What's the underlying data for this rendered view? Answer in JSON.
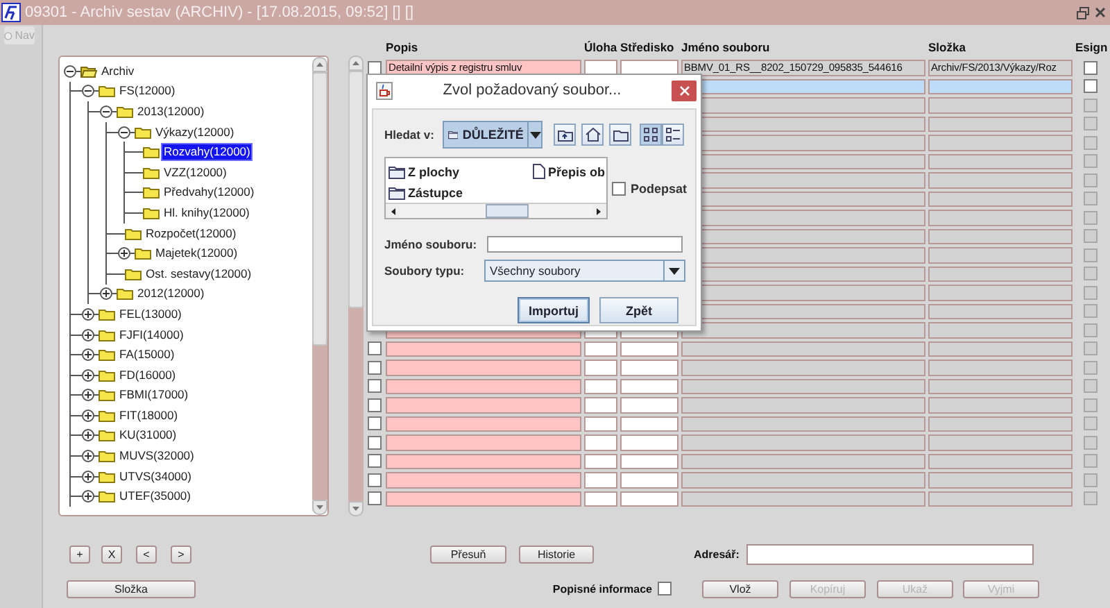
{
  "window": {
    "title": "09301 - Archiv sestav (ARCHIV) - [17.08.2015, 09:52] [] []"
  },
  "nav": {
    "label": "Nav",
    "disabled": true
  },
  "tree": {
    "items": [
      {
        "label": "Archiv",
        "expanded": true,
        "selected": false,
        "children": [
          {
            "label": "FS(12000)",
            "expanded": true,
            "selected": false,
            "children": [
              {
                "label": "2013(12000)",
                "expanded": true,
                "selected": false,
                "children": [
                  {
                    "label": "Výkazy(12000)",
                    "expanded": true,
                    "selected": false,
                    "children": [
                      {
                        "label": "Rozvahy(12000)",
                        "selected": true
                      },
                      {
                        "label": "VZZ(12000)",
                        "selected": false
                      },
                      {
                        "label": "Předvahy(12000)",
                        "selected": false
                      },
                      {
                        "label": "Hl. knihy(12000)",
                        "selected": false
                      }
                    ]
                  },
                  {
                    "label": "Rozpočet(12000)",
                    "selected": false
                  },
                  {
                    "label": "Majetek(12000)",
                    "expanded": false,
                    "selected": false
                  },
                  {
                    "label": "Ost. sestavy(12000)",
                    "selected": false
                  }
                ]
              },
              {
                "label": "2012(12000)",
                "expanded": false,
                "selected": false
              }
            ]
          },
          {
            "label": "FEL(13000)",
            "expanded": false,
            "selected": false
          },
          {
            "label": "FJFI(14000)",
            "expanded": false,
            "selected": false
          },
          {
            "label": "FA(15000)",
            "expanded": false,
            "selected": false
          },
          {
            "label": "FD(16000)",
            "expanded": false,
            "selected": false
          },
          {
            "label": "FBMI(17000)",
            "expanded": false,
            "selected": false
          },
          {
            "label": "FIT(18000)",
            "expanded": false,
            "selected": false
          },
          {
            "label": "KU(31000)",
            "expanded": false,
            "selected": false
          },
          {
            "label": "MUVS(32000)",
            "expanded": false,
            "selected": false
          },
          {
            "label": "UTVS(34000)",
            "expanded": false,
            "selected": false
          },
          {
            "label": "UTEF(35000)",
            "expanded": false,
            "selected": false
          }
        ]
      }
    ]
  },
  "table": {
    "columns": [
      "Popis",
      "Úloha",
      "Středisko",
      "Jméno souboru",
      "Složka",
      "Esign"
    ],
    "rows": [
      {
        "checked": false,
        "popis": "Detailní výpis z registru smluv",
        "soubor": "BBMV_01_RS__8202_150729_095835_544616",
        "slozka": "Archiv/FS/2013/Výkazy/Roz",
        "selected": false,
        "esign_checked": false,
        "esign_disabled": false
      },
      {
        "selected": true,
        "esign_checked": false,
        "esign_disabled": false
      },
      {
        "selected": false,
        "esign_checked": false,
        "esign_disabled": true
      },
      {
        "selected": false,
        "esign_checked": false,
        "esign_disabled": true
      },
      {
        "selected": false,
        "esign_checked": false,
        "esign_disabled": true
      },
      {
        "selected": false,
        "esign_checked": false,
        "esign_disabled": true
      },
      {
        "selected": false,
        "esign_checked": false,
        "esign_disabled": true
      },
      {
        "selected": false,
        "esign_checked": false,
        "esign_disabled": true
      },
      {
        "selected": false,
        "esign_checked": false,
        "esign_disabled": true
      },
      {
        "selected": false,
        "esign_checked": false,
        "esign_disabled": true
      },
      {
        "selected": false,
        "esign_checked": false,
        "esign_disabled": true
      },
      {
        "selected": false,
        "esign_checked": false,
        "esign_disabled": true
      },
      {
        "selected": false,
        "esign_checked": false,
        "esign_disabled": true
      },
      {
        "selected": false,
        "esign_checked": false,
        "esign_disabled": true
      },
      {
        "selected": false,
        "esign_checked": false,
        "esign_disabled": true
      },
      {
        "checked": false,
        "selected": false,
        "esign_checked": false,
        "esign_disabled": true
      },
      {
        "checked": false,
        "selected": false,
        "esign_checked": false,
        "esign_disabled": true
      },
      {
        "checked": false,
        "selected": false,
        "esign_checked": false,
        "esign_disabled": true
      },
      {
        "checked": false,
        "selected": false,
        "esign_checked": false,
        "esign_disabled": true
      },
      {
        "checked": false,
        "selected": false,
        "esign_checked": false,
        "esign_disabled": true
      },
      {
        "checked": false,
        "selected": false,
        "esign_checked": false,
        "esign_disabled": true
      },
      {
        "checked": false,
        "selected": false,
        "esign_checked": false,
        "esign_disabled": true
      },
      {
        "checked": false,
        "selected": false,
        "esign_checked": false,
        "esign_disabled": true
      },
      {
        "checked": false,
        "selected": false,
        "esign_checked": false,
        "esign_disabled": true
      }
    ]
  },
  "dialog": {
    "title": "Zvol požadovaný soubor...",
    "look_in_label": "Hledat v:",
    "look_in_value": "DŮLEŽITÉ",
    "view_modes": [
      {
        "kind": "list",
        "selected": true
      },
      {
        "kind": "details",
        "selected": false
      }
    ],
    "files": [
      {
        "kind": "folder",
        "name": "Z plochy"
      },
      {
        "kind": "folder",
        "name": "Zástupce"
      },
      {
        "kind": "file",
        "name": "Přepis ob"
      }
    ],
    "sign": {
      "label": "Podepsat",
      "checked": false
    },
    "file_name": {
      "label": "Jméno souboru:"
    },
    "file_type": {
      "label": "Soubory typu:",
      "value": "Všechny soubory"
    },
    "buttons": [
      {
        "label": "Importuj",
        "focused": true
      },
      {
        "label": "Zpět",
        "focused": false
      }
    ]
  },
  "tree_buttons": [
    "+",
    "X",
    "<",
    ">"
  ],
  "folder_button": "Složka",
  "move_button": "Přesuň",
  "history_button": "Historie",
  "address": {
    "label": "Adresář:"
  },
  "description_info": {
    "label": "Popisné informace",
    "checked": false
  },
  "actions": [
    {
      "label": "Vlož",
      "disabled": false
    },
    {
      "label": "Kopíruj",
      "disabled": true
    },
    {
      "label": "Ukaž",
      "disabled": true
    },
    {
      "label": "Vyjmi",
      "disabled": true
    }
  ]
}
